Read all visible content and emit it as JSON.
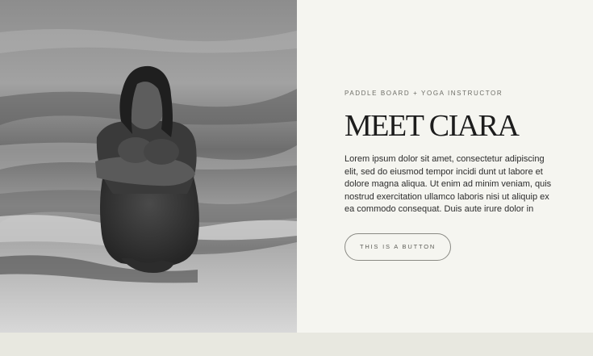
{
  "hero": {
    "eyebrow": "PADDLE BOARD + YOGA INSTRUCTOR",
    "title": "MEET CIARA",
    "body": "Lorem ipsum dolor sit amet, consectetur adipiscing elit, sed do eiusmod tempor incidi dunt ut labore et dolore magna aliqua. Ut enim ad minim veniam, quis nostrud exercitation ullamco laboris nisi ut aliquip ex ea commodo consequat. Duis aute irure dolor in",
    "button_label": "THIS IS A BUTTON"
  },
  "colors": {
    "background": "#f5f5f0",
    "bottom_band": "#e8e8e0",
    "title": "#1c1c1c",
    "button_border": "#8a8a84"
  },
  "image": {
    "description_icon": "beach-portrait-photo"
  }
}
